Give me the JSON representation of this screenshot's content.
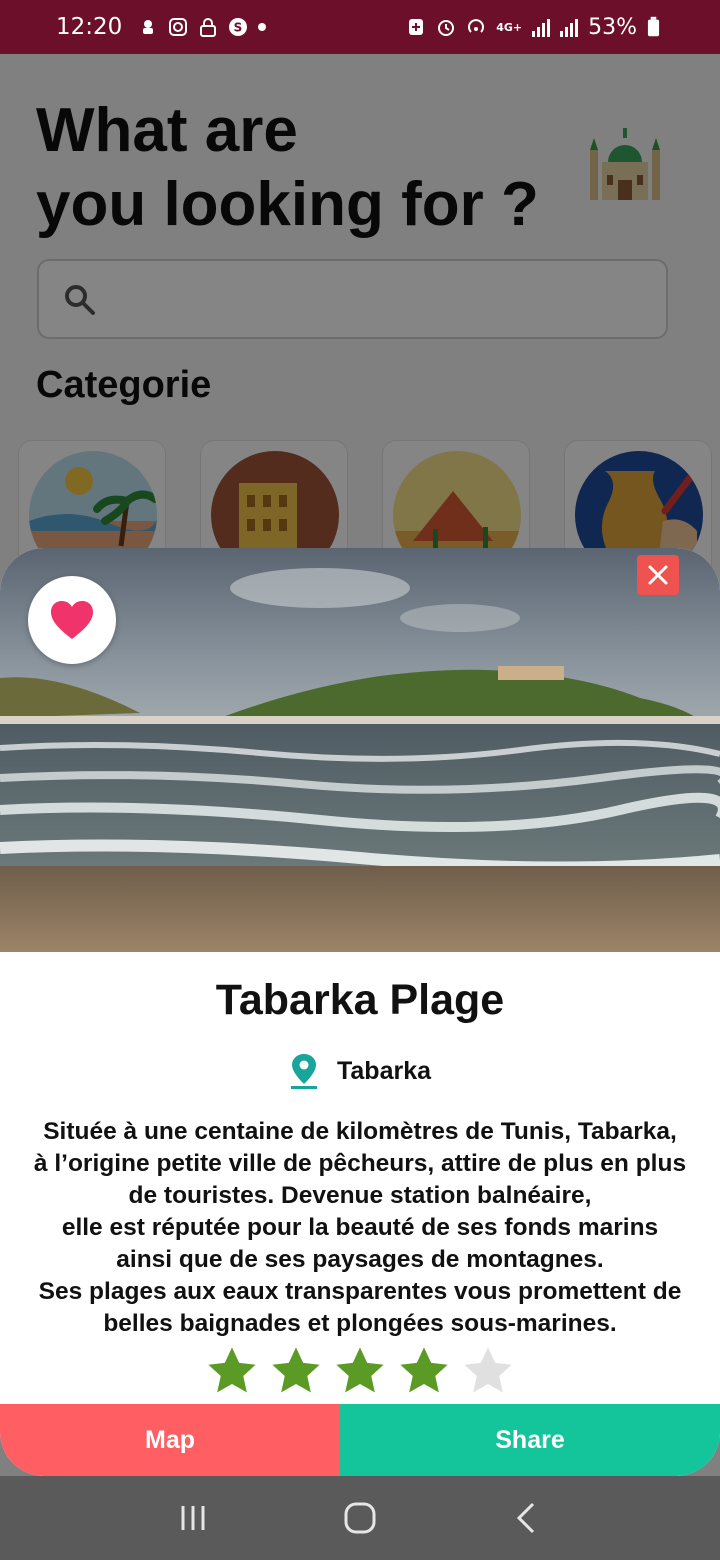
{
  "status_bar": {
    "time": "12:20",
    "battery": "53%",
    "network": "4G+"
  },
  "background": {
    "title_line1": "What are",
    "title_line2": "you looking for ?",
    "search": {
      "placeholder": ""
    },
    "section_title": "Categorie",
    "categories": [
      {
        "icon": "beach-icon"
      },
      {
        "icon": "colosseum-icon"
      },
      {
        "icon": "desert-icon"
      },
      {
        "icon": "pottery-icon"
      }
    ]
  },
  "modal": {
    "title": "Tabarka Plage",
    "location": "Tabarka",
    "description_lines": [
      "Située à une centaine de kilomètres de Tunis, Tabarka,",
      "à l’origine petite ville de pêcheurs, attire de plus en plus",
      "de touristes. Devenue station balnéaire,",
      "elle est réputée pour la beauté de ses fonds marins",
      "ainsi que de ses paysages de montagnes.",
      "Ses plages aux eaux transparentes vous promettent de",
      "belles baignades et plongées sous-marines."
    ],
    "rating": 4,
    "rating_max": 5,
    "map_label": "Map",
    "share_label": "Share"
  },
  "colors": {
    "status_bar": "#6b0f2a",
    "favorite": "#f0336b",
    "close": "#ef5350",
    "map_button": "#ff5f63",
    "share_button": "#14c49a",
    "star_filled": "#5a9a25",
    "star_empty": "#e0e0e0",
    "location_pin": "#1aa59a"
  }
}
